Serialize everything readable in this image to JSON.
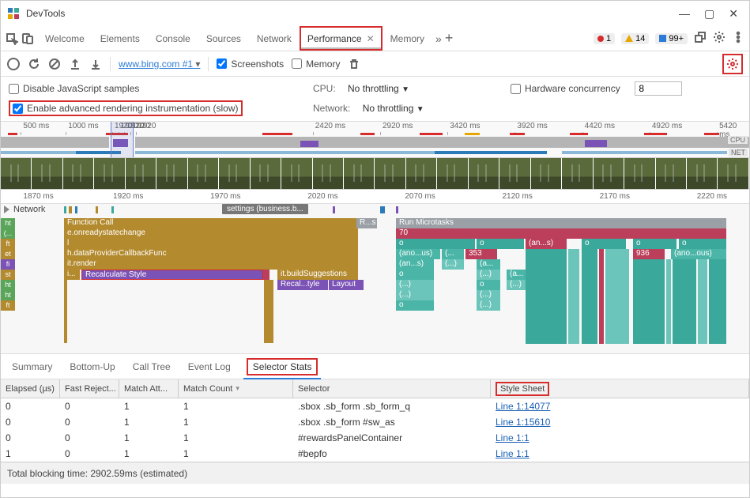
{
  "window": {
    "title": "DevTools"
  },
  "tabs": {
    "welcome": "Welcome",
    "elements": "Elements",
    "console": "Console",
    "sources": "Sources",
    "network": "Network",
    "performance": "Performance",
    "memory": "Memory"
  },
  "badges": {
    "errors": "1",
    "warnings": "14",
    "prompts": "99+"
  },
  "subtoolbar": {
    "page": "www.bing.com #1",
    "screenshots": "Screenshots",
    "memory": "Memory"
  },
  "settings": {
    "disable_js": "Disable JavaScript samples",
    "advanced": "Enable advanced rendering instrumentation (slow)",
    "cpu_label": "CPU:",
    "cpu_value": "No throttling",
    "net_label": "Network:",
    "net_value": "No throttling",
    "hw_label": "Hardware concurrency",
    "hw_value": "8"
  },
  "overview": {
    "ticks": [
      "500 ms",
      "1000 ms",
      "1920",
      "1920",
      "1920",
      "1920",
      "1920",
      "2420 ms",
      "2920 ms",
      "3420 ms",
      "3920 ms",
      "4420 ms",
      "4920 ms",
      "5420 ms"
    ],
    "cpu_label": "CPU",
    "net_label": "NET"
  },
  "ruler2": [
    "1870 ms",
    "1920 ms",
    "1970 ms",
    "2020 ms",
    "2070 ms",
    "2120 ms",
    "2170 ms",
    "2220 ms"
  ],
  "flame": {
    "network_label": "Network",
    "task_chip": "settings (business.b...",
    "left_rows": [
      "ht",
      "(...",
      "ft",
      "et",
      "fi",
      "st",
      "ht",
      "ht",
      "ft"
    ],
    "bars": {
      "func": "Function Call",
      "ors": "e.onreadystatechange",
      "l": "l",
      "dp": "h.dataProviderCallbackFunc",
      "itr": "it.render",
      "i": "i...",
      "recalc": "Recalculate Style",
      "bs": "it.buildSuggestions",
      "recal2": "Recal...tyle",
      "layout": "Layout",
      "rs": "R...s",
      "rmt": "Run Microtasks",
      "seventy": "70",
      "o": "o",
      "an_s": "(an...s)",
      "ano_us": "(ano...us)",
      "num353": "353",
      "num936": "936",
      "ano_ous": "(ano...ous)",
      "paren": "(...",
      "ell": "(...)",
      "a": "(a..."
    }
  },
  "bottom_tabs": {
    "summary": "Summary",
    "bottom_up": "Bottom-Up",
    "call_tree": "Call Tree",
    "event_log": "Event Log",
    "selector_stats": "Selector Stats"
  },
  "table": {
    "headers": {
      "elapsed": "Elapsed (µs)",
      "fast_reject": "Fast Reject...",
      "match_att": "Match Att...",
      "match_count": "Match Count",
      "selector": "Selector",
      "style_sheet": "Style Sheet"
    },
    "rows": [
      {
        "e": "0",
        "f": "0",
        "ma": "1",
        "mc": "1",
        "sel": ".sbox .sb_form .sb_form_q",
        "ss": "Line 1:14077"
      },
      {
        "e": "0",
        "f": "0",
        "ma": "1",
        "mc": "1",
        "sel": ".sbox .sb_form #sw_as",
        "ss": "Line 1:15610"
      },
      {
        "e": "0",
        "f": "0",
        "ma": "1",
        "mc": "1",
        "sel": "#rewardsPanelContainer",
        "ss": "Line 1:1"
      },
      {
        "e": "1",
        "f": "0",
        "ma": "1",
        "mc": "1",
        "sel": "#bepfo",
        "ss": "Line 1:1"
      }
    ]
  },
  "footer": "Total blocking time: 2902.59ms (estimated)"
}
